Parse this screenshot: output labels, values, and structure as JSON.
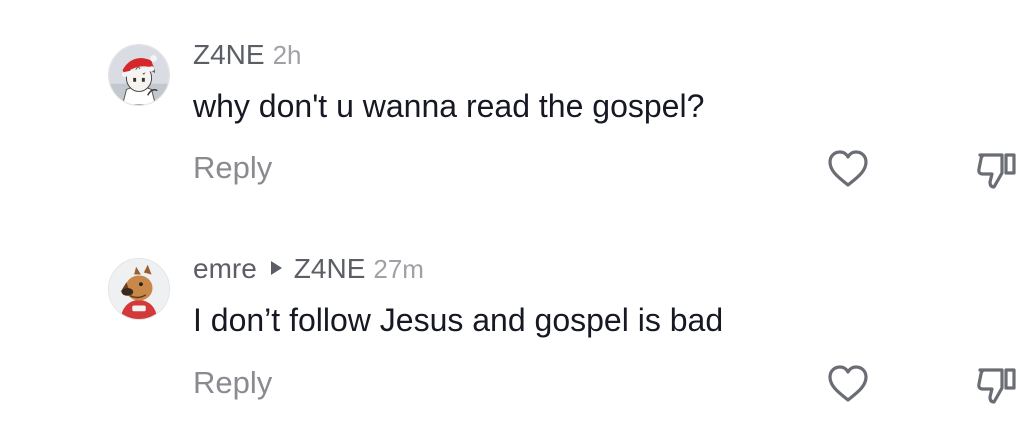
{
  "comments": [
    {
      "username": "Z4NE",
      "reply_to": "",
      "time": "2h",
      "text": "why don't u wanna read the gospel?",
      "reply_label": "Reply",
      "avatar_icon": "anime-character-santa-hat-avatar",
      "like_icon": "heart-outline-icon",
      "dislike_icon": "thumbs-down-icon"
    },
    {
      "username": "emre",
      "reply_to": "Z4NE",
      "time": "27m",
      "text": "I don’t follow Jesus and gospel is bad",
      "reply_label": "Reply",
      "avatar_icon": "cartoon-dog-avatar",
      "like_icon": "heart-outline-icon",
      "dislike_icon": "thumbs-down-icon"
    }
  ],
  "colors": {
    "username": "#5c5e66",
    "time": "#9fa1a7",
    "text": "#161823",
    "reply": "#8a8b91",
    "icon": "#6b6d74"
  }
}
